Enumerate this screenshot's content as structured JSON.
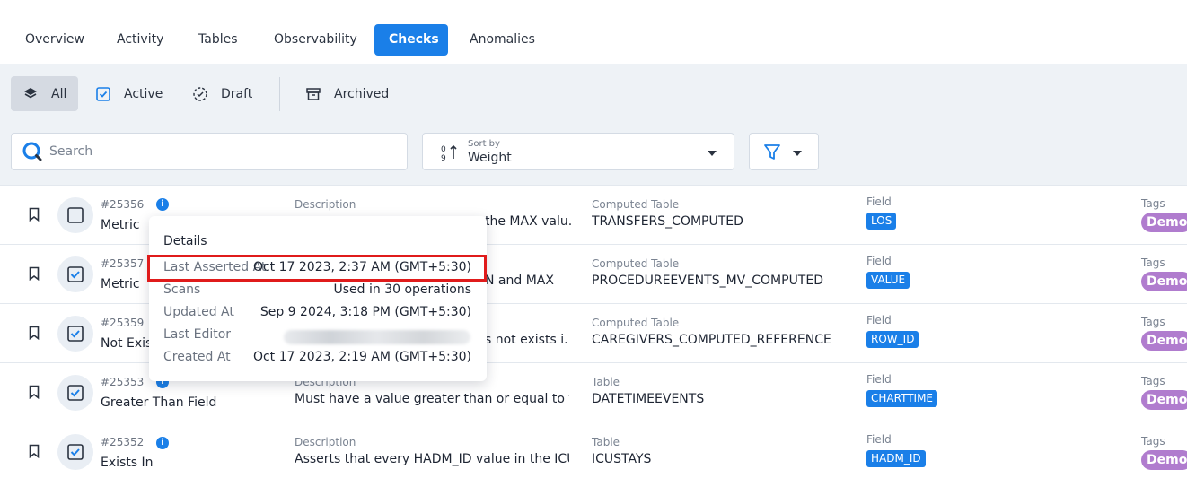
{
  "nav": {
    "tabs": [
      "Overview",
      "Activity",
      "Tables",
      "Observability",
      "Checks",
      "Anomalies"
    ],
    "active": "Checks"
  },
  "filters": {
    "all": "All",
    "active": "Active",
    "draft": "Draft",
    "archived": "Archived"
  },
  "search": {
    "placeholder": "Search"
  },
  "sort": {
    "caption": "Sort by",
    "value": "Weight"
  },
  "labels": {
    "description": "Description",
    "field": "Field",
    "tags": "Tags"
  },
  "rows": [
    {
      "id": "#25356",
      "name": "Metric",
      "desc": "the MAX valu...",
      "table_label": "Computed Table",
      "table": "TRANSFERS_COMPUTED",
      "field": "LOS",
      "tag": "Demo",
      "checked": false
    },
    {
      "id": "#25357",
      "name": "Metric",
      "desc": "N and MAX",
      "table_label": "Computed Table",
      "table": "PROCEDUREEVENTS_MV_COMPUTED",
      "field": "VALUE",
      "tag": "Demo",
      "checked": true
    },
    {
      "id": "#25359",
      "name": "Not Exis",
      "desc": "s not exists i...",
      "table_label": "Computed Table",
      "table": "CAREGIVERS_COMPUTED_REFERENCE",
      "field": "ROW_ID",
      "tag": "Demo",
      "checked": true
    },
    {
      "id": "#25353",
      "name": "Greater Than Field",
      "desc": "Must have a value greater than or equal to the ...",
      "table_label": "Table",
      "table": "DATETIMEEVENTS",
      "field": "CHARTTIME",
      "tag": "Demo",
      "checked": true
    },
    {
      "id": "#25352",
      "name": "Exists In",
      "desc": "Asserts that every HADM_ID value in the ICUS...",
      "table_label": "Table",
      "table": "ICUSTAYS",
      "field": "HADM_ID",
      "tag": "Demo",
      "checked": true
    }
  ],
  "popup": {
    "title": "Details",
    "items": [
      {
        "key": "Last Asserted At",
        "value": "Oct 17 2023, 2:37 AM (GMT+5:30)"
      },
      {
        "key": "Scans",
        "value": "Used in 30 operations"
      },
      {
        "key": "Updated At",
        "value": "Sep 9 2024, 3:18 PM (GMT+5:30)"
      },
      {
        "key": "Last Editor",
        "value": ""
      },
      {
        "key": "Created At",
        "value": "Oct 17 2023, 2:19 AM (GMT+5:30)"
      }
    ]
  },
  "colors": {
    "accent": "#1a7fe8",
    "tag": "#b07cce",
    "highlight": "#e01b1b"
  }
}
